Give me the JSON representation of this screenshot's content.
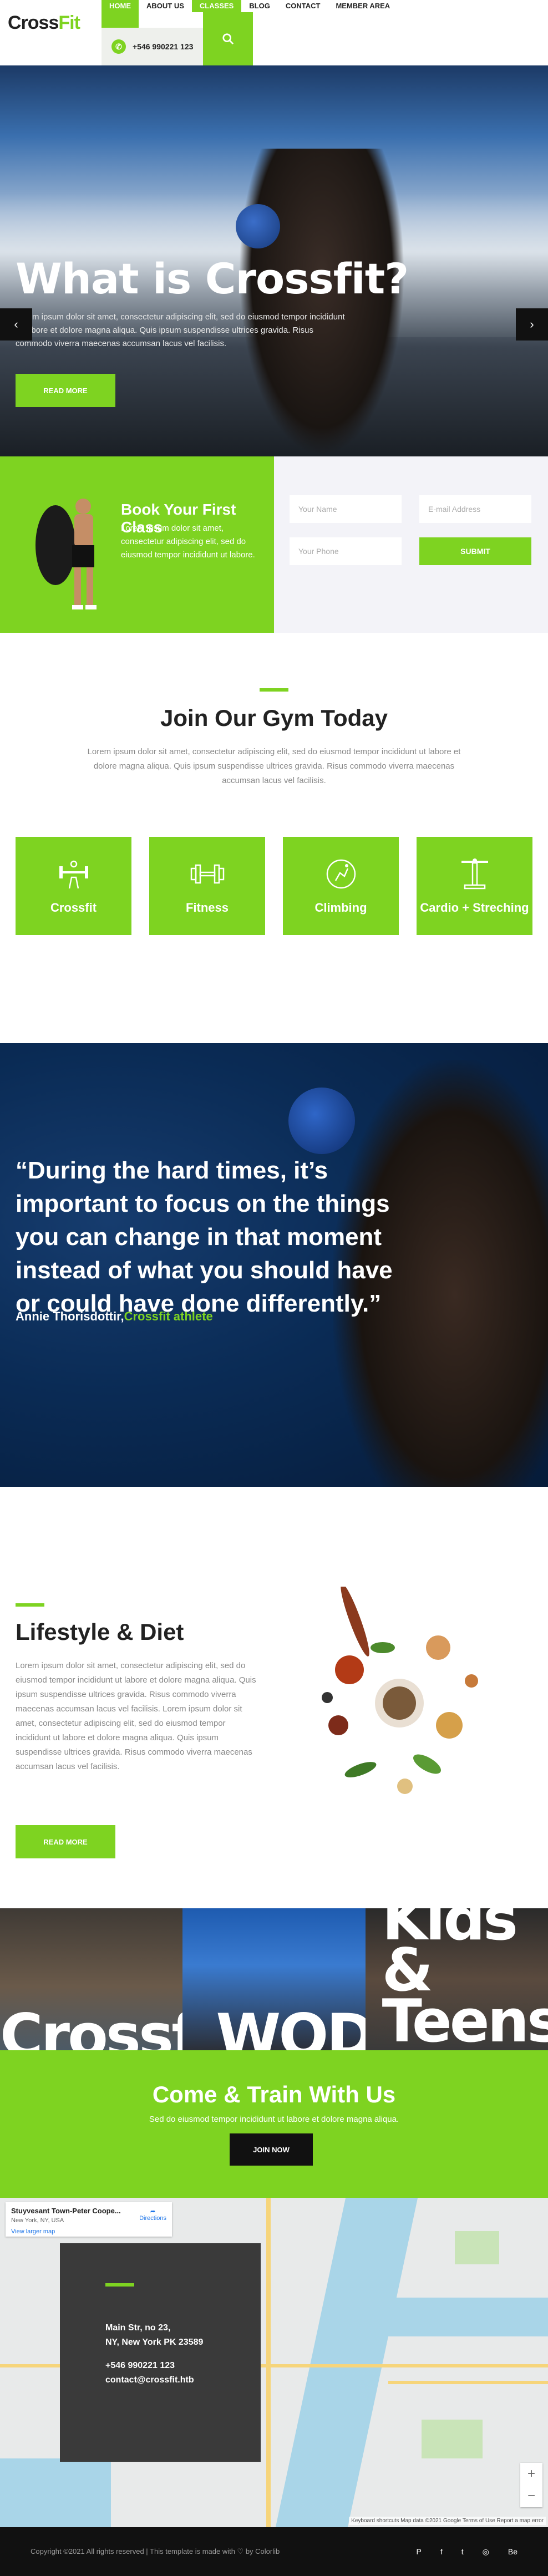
{
  "nav": {
    "logo_a": "Cross",
    "logo_b": "Fit",
    "items": [
      "HOME",
      "ABOUT US",
      "CLASSES",
      "BLOG",
      "CONTACT",
      "MEMBER AREA"
    ],
    "phone": "+546 990221 123"
  },
  "hero": {
    "title": "What is Crossfit?",
    "text": "Lorem ipsum dolor sit amet, consectetur adipiscing elit, sed do eiusmod tempor incididunt ut labore et dolore magna aliqua. Quis ipsum suspendisse ultrices gravida. Risus commodo viverra maecenas accumsan lacus vel facilisis.",
    "button": "READ MORE",
    "prev": "‹",
    "next": "›"
  },
  "book": {
    "title": "Book Your First Class",
    "text": "Lorem ipsum dolor sit amet, consectetur adipiscing elit, sed do eiusmod tempor incididunt ut labore.",
    "name_placeholder": "Your Name",
    "email_placeholder": "E-mail Address",
    "phone_placeholder": "Your Phone",
    "submit": "SUBMIT"
  },
  "join": {
    "title": "Join Our Gym Today",
    "text": "Lorem ipsum dolor sit amet, consectetur adipiscing elit, sed do eiusmod tempor incididunt ut labore et dolore magna aliqua. Quis ipsum suspendisse ultrices gravida. Risus commodo viverra maecenas accumsan lacus vel facilisis.",
    "cards": [
      {
        "label": "Crossfit",
        "icon": "barbell-icon"
      },
      {
        "label": "Fitness",
        "icon": "dumbbell-icon"
      },
      {
        "label": "Climbing",
        "icon": "climbing-icon"
      },
      {
        "label": "Cardio + Streching",
        "icon": "cardio-icon"
      }
    ]
  },
  "quote": {
    "text": "“During the hard times, it’s important to focus on the things you can change in that moment instead of what you should have or could have done differently.”",
    "author": "Annie Thorisdottir,",
    "author_role": "Crossfit athlete"
  },
  "lifestyle": {
    "title": "Lifestyle & Diet",
    "text": "Lorem ipsum dolor sit amet, consectetur adipiscing elit, sed do eiusmod tempor incididunt ut labore et dolore magna aliqua. Quis ipsum suspendisse ultrices gravida. Risus commodo viverra maecenas accumsan lacus vel facilisis. Lorem ipsum dolor sit amet, consectetur adipiscing elit, sed do eiusmod tempor incididunt ut labore et dolore magna aliqua. Quis ipsum suspendisse ultrices gravida. Risus commodo viverra maecenas accumsan lacus vel facilisis.",
    "button": "READ MORE"
  },
  "programs": [
    {
      "label": "Crossfit"
    },
    {
      "label": "WOD"
    },
    {
      "label": "Kids & Teens"
    }
  ],
  "train": {
    "title": "Come & Train With Us",
    "text": "Sed do eiusmod tempor incididunt ut labore et dolore magna aliqua.",
    "button": "JOIN NOW"
  },
  "map": {
    "place_name": "Stuyvesant Town-Peter Coope...",
    "place_address": "New York, NY, USA",
    "larger_map": "View larger map",
    "directions": "Directions",
    "address_line1": "Main Str, no 23,",
    "address_line2": "NY, New York PK 23589",
    "phone": "+546 990221 123",
    "email": "contact@crossfit.htb",
    "footer_note": "Keyboard shortcuts  Map data ©2021 Google  Terms of Use  Report a map error"
  },
  "footer": {
    "copyright": "Copyright ©2021 All rights reserved | This template is made with ♡ by Colorlib",
    "social": [
      "P",
      "f",
      "t",
      "◎",
      "Be"
    ]
  },
  "colors": {
    "accent": "#7ed321",
    "dark": "#111111"
  }
}
